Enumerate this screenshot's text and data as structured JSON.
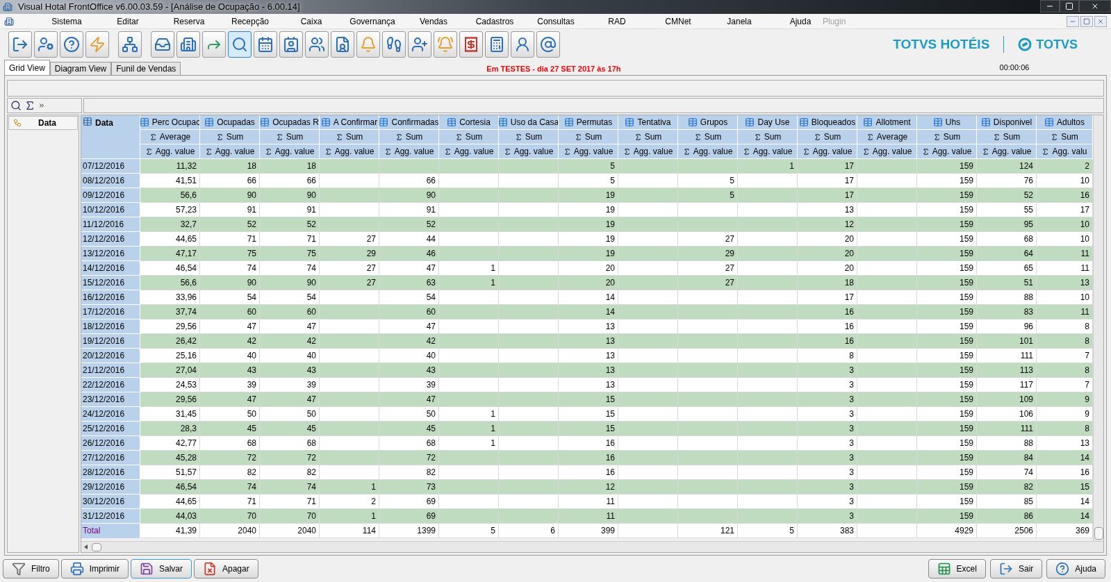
{
  "window": {
    "title": "Visual Hotal FrontOffice v6.00.03.59 - [Análise de Ocupação - 6.00.14]"
  },
  "menu": [
    {
      "label": "Sistema",
      "disabled": false
    },
    {
      "label": "Editar",
      "disabled": false
    },
    {
      "label": "Reserva",
      "disabled": false
    },
    {
      "label": "Recepção",
      "disabled": false
    },
    {
      "label": "Caixa",
      "disabled": false
    },
    {
      "label": "Governança",
      "disabled": false
    },
    {
      "label": "Vendas",
      "disabled": false
    },
    {
      "label": "Cadastros",
      "disabled": false
    },
    {
      "label": "Consultas",
      "disabled": false
    },
    {
      "label": "RAD",
      "disabled": false
    },
    {
      "label": "CMNet",
      "disabled": false
    },
    {
      "label": "Janela",
      "disabled": false
    },
    {
      "label": "Ajuda",
      "disabled": false
    },
    {
      "label": "Plugin",
      "disabled": true
    }
  ],
  "toolbar": [
    {
      "selected": false
    },
    {
      "selected": false
    },
    {
      "selected": false
    },
    {
      "selected": false
    },
    {
      "selected": false
    },
    {
      "selected": false
    },
    {
      "selected": false
    },
    {
      "selected": false
    },
    {
      "selected": true
    },
    {
      "selected": false
    },
    {
      "selected": false
    },
    {
      "selected": false
    },
    {
      "selected": false
    },
    {
      "selected": false
    },
    {
      "selected": false
    },
    {
      "selected": false
    },
    {
      "selected": false
    },
    {
      "selected": false
    },
    {
      "selected": false
    },
    {
      "selected": false
    },
    {
      "selected": false
    }
  ],
  "brand": {
    "product": "TOTVS HOTÉIS",
    "company": "TOTVS"
  },
  "tabs": [
    {
      "label": "Grid View",
      "selected": true
    },
    {
      "label": "Diagram View",
      "selected": false
    },
    {
      "label": "Funil de Vendas",
      "selected": false
    }
  ],
  "notice": "Em TESTES - dia 27 SET 2017 às 17h",
  "timer": "00:00:06",
  "row_field": "Data",
  "grid": {
    "row_header": "Data",
    "columns": [
      {
        "label": "Perc Ocupac",
        "agg": "Average",
        "value": "Agg. value"
      },
      {
        "label": "Ocupadas",
        "agg": "Sum",
        "value": "Agg. value"
      },
      {
        "label": "Ocupadas R",
        "agg": "Sum",
        "value": "Agg. value"
      },
      {
        "label": "A Confirmar",
        "agg": "Sum",
        "value": "Agg. value"
      },
      {
        "label": "Confirmadas",
        "agg": "Sum",
        "value": "Agg. value"
      },
      {
        "label": "Cortesia",
        "agg": "Sum",
        "value": "Agg. value"
      },
      {
        "label": "Uso da Casa",
        "agg": "Sum",
        "value": "Agg. value"
      },
      {
        "label": "Permutas",
        "agg": "Sum",
        "value": "Agg. value"
      },
      {
        "label": "Tentativa",
        "agg": "Sum",
        "value": "Agg. value"
      },
      {
        "label": "Grupos",
        "agg": "Sum",
        "value": "Agg. value"
      },
      {
        "label": "Day Use",
        "agg": "Sum",
        "value": "Agg. value"
      },
      {
        "label": "Bloqueados",
        "agg": "Sum",
        "value": "Agg. value"
      },
      {
        "label": "Allotment",
        "agg": "Average",
        "value": "Agg. value"
      },
      {
        "label": "Uhs",
        "agg": "Sum",
        "value": "Agg. value"
      },
      {
        "label": "Disponivel",
        "agg": "Sum",
        "value": "Agg. value"
      },
      {
        "label": "Adultos",
        "agg": "Sum",
        "value": "Agg. valu"
      }
    ],
    "rows": [
      {
        "date": "07/12/2016",
        "cells": [
          "11,32",
          "18",
          "18",
          null,
          null,
          null,
          null,
          "5",
          null,
          null,
          "1",
          "17",
          null,
          "159",
          "124",
          "2"
        ]
      },
      {
        "date": "08/12/2016",
        "cells": [
          "41,51",
          "66",
          "66",
          null,
          "66",
          null,
          null,
          "5",
          null,
          "5",
          null,
          "17",
          null,
          "159",
          "76",
          "10"
        ]
      },
      {
        "date": "09/12/2016",
        "cells": [
          "56,6",
          "90",
          "90",
          null,
          "90",
          null,
          null,
          "19",
          null,
          "5",
          null,
          "17",
          null,
          "159",
          "52",
          "16"
        ]
      },
      {
        "date": "10/12/2016",
        "cells": [
          "57,23",
          "91",
          "91",
          null,
          "91",
          null,
          null,
          "19",
          null,
          null,
          null,
          "13",
          null,
          "159",
          "55",
          "17"
        ]
      },
      {
        "date": "11/12/2016",
        "cells": [
          "32,7",
          "52",
          "52",
          null,
          "52",
          null,
          null,
          "19",
          null,
          null,
          null,
          "12",
          null,
          "159",
          "95",
          "10"
        ]
      },
      {
        "date": "12/12/2016",
        "cells": [
          "44,65",
          "71",
          "71",
          "27",
          "44",
          null,
          null,
          "19",
          null,
          "27",
          null,
          "20",
          null,
          "159",
          "68",
          "10"
        ]
      },
      {
        "date": "13/12/2016",
        "cells": [
          "47,17",
          "75",
          "75",
          "29",
          "46",
          null,
          null,
          "19",
          null,
          "29",
          null,
          "20",
          null,
          "159",
          "64",
          "11"
        ]
      },
      {
        "date": "14/12/2016",
        "cells": [
          "46,54",
          "74",
          "74",
          "27",
          "47",
          "1",
          null,
          "20",
          null,
          "27",
          null,
          "20",
          null,
          "159",
          "65",
          "11"
        ]
      },
      {
        "date": "15/12/2016",
        "cells": [
          "56,6",
          "90",
          "90",
          "27",
          "63",
          "1",
          null,
          "20",
          null,
          "27",
          null,
          "18",
          null,
          "159",
          "51",
          "13"
        ]
      },
      {
        "date": "16/12/2016",
        "cells": [
          "33,96",
          "54",
          "54",
          null,
          "54",
          null,
          null,
          "14",
          null,
          null,
          null,
          "17",
          null,
          "159",
          "88",
          "10"
        ]
      },
      {
        "date": "17/12/2016",
        "cells": [
          "37,74",
          "60",
          "60",
          null,
          "60",
          null,
          null,
          "14",
          null,
          null,
          null,
          "16",
          null,
          "159",
          "83",
          "11"
        ]
      },
      {
        "date": "18/12/2016",
        "cells": [
          "29,56",
          "47",
          "47",
          null,
          "47",
          null,
          null,
          "13",
          null,
          null,
          null,
          "16",
          null,
          "159",
          "96",
          "8"
        ]
      },
      {
        "date": "19/12/2016",
        "cells": [
          "26,42",
          "42",
          "42",
          null,
          "42",
          null,
          null,
          "13",
          null,
          null,
          null,
          "16",
          null,
          "159",
          "101",
          "8"
        ]
      },
      {
        "date": "20/12/2016",
        "cells": [
          "25,16",
          "40",
          "40",
          null,
          "40",
          null,
          null,
          "13",
          null,
          null,
          null,
          "8",
          null,
          "159",
          "111",
          "7"
        ]
      },
      {
        "date": "21/12/2016",
        "cells": [
          "27,04",
          "43",
          "43",
          null,
          "43",
          null,
          null,
          "13",
          null,
          null,
          null,
          "3",
          null,
          "159",
          "113",
          "8"
        ]
      },
      {
        "date": "22/12/2016",
        "cells": [
          "24,53",
          "39",
          "39",
          null,
          "39",
          null,
          null,
          "13",
          null,
          null,
          null,
          "3",
          null,
          "159",
          "117",
          "7"
        ]
      },
      {
        "date": "23/12/2016",
        "cells": [
          "29,56",
          "47",
          "47",
          null,
          "47",
          null,
          null,
          "15",
          null,
          null,
          null,
          "3",
          null,
          "159",
          "109",
          "9"
        ]
      },
      {
        "date": "24/12/2016",
        "cells": [
          "31,45",
          "50",
          "50",
          null,
          "50",
          "1",
          null,
          "15",
          null,
          null,
          null,
          "3",
          null,
          "159",
          "106",
          "9"
        ]
      },
      {
        "date": "25/12/2016",
        "cells": [
          "28,3",
          "45",
          "45",
          null,
          "45",
          "1",
          null,
          "15",
          null,
          null,
          null,
          "3",
          null,
          "159",
          "111",
          "8"
        ]
      },
      {
        "date": "26/12/2016",
        "cells": [
          "42,77",
          "68",
          "68",
          null,
          "68",
          "1",
          null,
          "16",
          null,
          null,
          null,
          "3",
          null,
          "159",
          "88",
          "13"
        ]
      },
      {
        "date": "27/12/2016",
        "cells": [
          "45,28",
          "72",
          "72",
          null,
          "72",
          null,
          null,
          "16",
          null,
          null,
          null,
          "3",
          null,
          "159",
          "84",
          "14"
        ]
      },
      {
        "date": "28/12/2016",
        "cells": [
          "51,57",
          "82",
          "82",
          null,
          "82",
          null,
          null,
          "16",
          null,
          null,
          null,
          "3",
          null,
          "159",
          "74",
          "16"
        ]
      },
      {
        "date": "29/12/2016",
        "cells": [
          "46,54",
          "74",
          "74",
          "1",
          "73",
          null,
          null,
          "12",
          null,
          null,
          null,
          "3",
          null,
          "159",
          "82",
          "15"
        ]
      },
      {
        "date": "30/12/2016",
        "cells": [
          "44,65",
          "71",
          "71",
          "2",
          "69",
          null,
          null,
          "11",
          null,
          null,
          null,
          "3",
          null,
          "159",
          "85",
          "14"
        ]
      },
      {
        "date": "31/12/2016",
        "cells": [
          "44,03",
          "70",
          "70",
          "1",
          "69",
          null,
          null,
          "11",
          null,
          null,
          null,
          "3",
          null,
          "159",
          "86",
          "14"
        ]
      }
    ],
    "total": {
      "label": "Total",
      "cells": [
        "41,39",
        "2040",
        "2040",
        "114",
        "1399",
        "5",
        "6",
        "399",
        null,
        "121",
        "5",
        "383",
        null,
        "4929",
        "2506",
        "369"
      ]
    }
  },
  "buttons_left": [
    {
      "label": "Filtro",
      "focused": false
    },
    {
      "label": "Imprimir",
      "focused": false
    },
    {
      "label": "Salvar",
      "focused": true
    },
    {
      "label": "Apagar",
      "focused": false
    }
  ],
  "buttons_right": [
    {
      "label": "Excel",
      "focused": false
    },
    {
      "label": "Sair",
      "focused": false
    },
    {
      "label": "Ajuda",
      "focused": false
    }
  ]
}
